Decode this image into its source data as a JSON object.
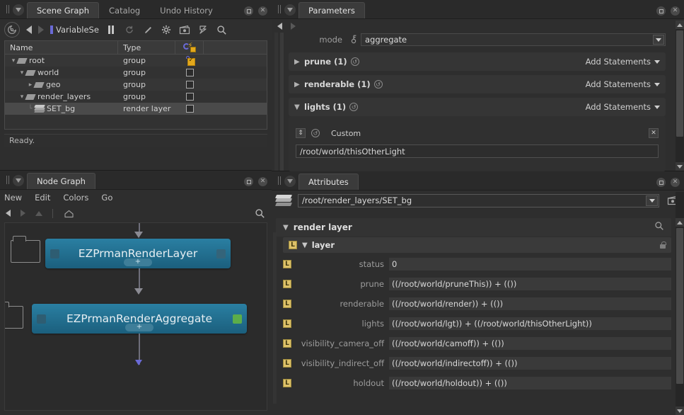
{
  "scene_graph": {
    "tabs": [
      {
        "label": "Scene Graph",
        "active": true
      },
      {
        "label": "Catalog",
        "active": false
      },
      {
        "label": "Undo History",
        "active": false
      }
    ],
    "toolbar": {
      "back_icon": "back-arrow-icon",
      "forward_icon": "forward-arrow-icon",
      "variable_label": "VariableSe",
      "pause_icon": "pause-icon",
      "refresh_icon": "refresh-icon",
      "pencil_icon": "pencil-icon",
      "gear_icon": "gear-icon",
      "camera_icon": "camera-icon",
      "bookmark_icon": "bookmark-icon",
      "search_icon": "search-icon"
    },
    "columns": [
      "Name",
      "Type",
      ""
    ],
    "rows": [
      {
        "name": "root",
        "type": "group",
        "indent": 0,
        "twisty": "▾",
        "icon": "group-icon",
        "checked": true,
        "selected": false
      },
      {
        "name": "world",
        "type": "group",
        "indent": 1,
        "twisty": "▾",
        "icon": "group-icon",
        "checked": false,
        "selected": false
      },
      {
        "name": "geo",
        "type": "group",
        "indent": 2,
        "twisty": "▸",
        "icon": "group-icon",
        "checked": false,
        "selected": false
      },
      {
        "name": "render_layers",
        "type": "group",
        "indent": 1,
        "twisty": "▾",
        "icon": "group-icon",
        "checked": false,
        "selected": false
      },
      {
        "name": "SET_bg",
        "type": "render layer",
        "indent": 2,
        "twisty": "",
        "icon": "layers-icon",
        "checked": false,
        "selected": true
      }
    ],
    "status": "Ready."
  },
  "node_graph": {
    "tabs": [
      {
        "label": "Node Graph",
        "active": true
      }
    ],
    "menu": [
      "New",
      "Edit",
      "Colors",
      "Go"
    ],
    "toolbar": {
      "back_icon": "back-arrow-icon",
      "forward_icon": "forward-arrow-icon",
      "up_icon": "up-arrow-icon",
      "home_icon": "home-icon",
      "search_icon": "search-icon"
    },
    "nodes": [
      {
        "name": "EZPrmanRenderLayer",
        "plus": "+",
        "right_port_color": "#34647a"
      },
      {
        "name": "EZPrmanRenderAggregate",
        "plus": "+",
        "right_port_color": "#5cad4a"
      }
    ]
  },
  "parameters": {
    "tabs": [
      {
        "label": "Parameters",
        "active": true
      }
    ],
    "mode": {
      "label": "mode",
      "value": "aggregate"
    },
    "groups": [
      {
        "name": "prune (1)",
        "expanded": false,
        "add_statements": "Add Statements"
      },
      {
        "name": "renderable (1)",
        "expanded": false,
        "add_statements": "Add Statements"
      },
      {
        "name": "lights (1)",
        "expanded": true,
        "add_statements": "Add Statements"
      }
    ],
    "lights_entry": {
      "title": "Custom",
      "value": "/root/world/thisOtherLight"
    }
  },
  "attributes": {
    "tabs": [
      {
        "label": "Attributes",
        "active": true
      }
    ],
    "path": "/root/render_layers/SET_bg",
    "section": {
      "name": "render layer",
      "expanded": true
    },
    "layer_group": {
      "name": "layer",
      "badge": "L",
      "expanded": true
    },
    "rows": [
      {
        "badge": "L",
        "label": "status",
        "value": "0"
      },
      {
        "badge": "L",
        "label": "prune",
        "value": "((/root/world/pruneThis)) + (())"
      },
      {
        "badge": "L",
        "label": "renderable",
        "value": "((/root/world/render)) + (())"
      },
      {
        "badge": "L",
        "label": "lights",
        "value": "((/root/world/lgt)) + ((/root/world/thisOtherLight))"
      },
      {
        "badge": "L",
        "label": "visibility_camera_off",
        "value": "((/root/world/camoff)) + (())"
      },
      {
        "badge": "L",
        "label": "visibility_indirect_off",
        "value": "((/root/world/indirectoff)) + (())"
      },
      {
        "badge": "L",
        "label": "holdout",
        "value": "((/root/world/holdout)) + (())"
      }
    ]
  },
  "window_buttons": {
    "maximize": "▣",
    "close": "✕"
  },
  "colors": {
    "node_blue": "#1b5f7d",
    "accent_green": "#5cad4a",
    "badge_yellow": "#ddc169",
    "selection": "#4a4a4a",
    "lock_purple": "#6a6ad6"
  }
}
